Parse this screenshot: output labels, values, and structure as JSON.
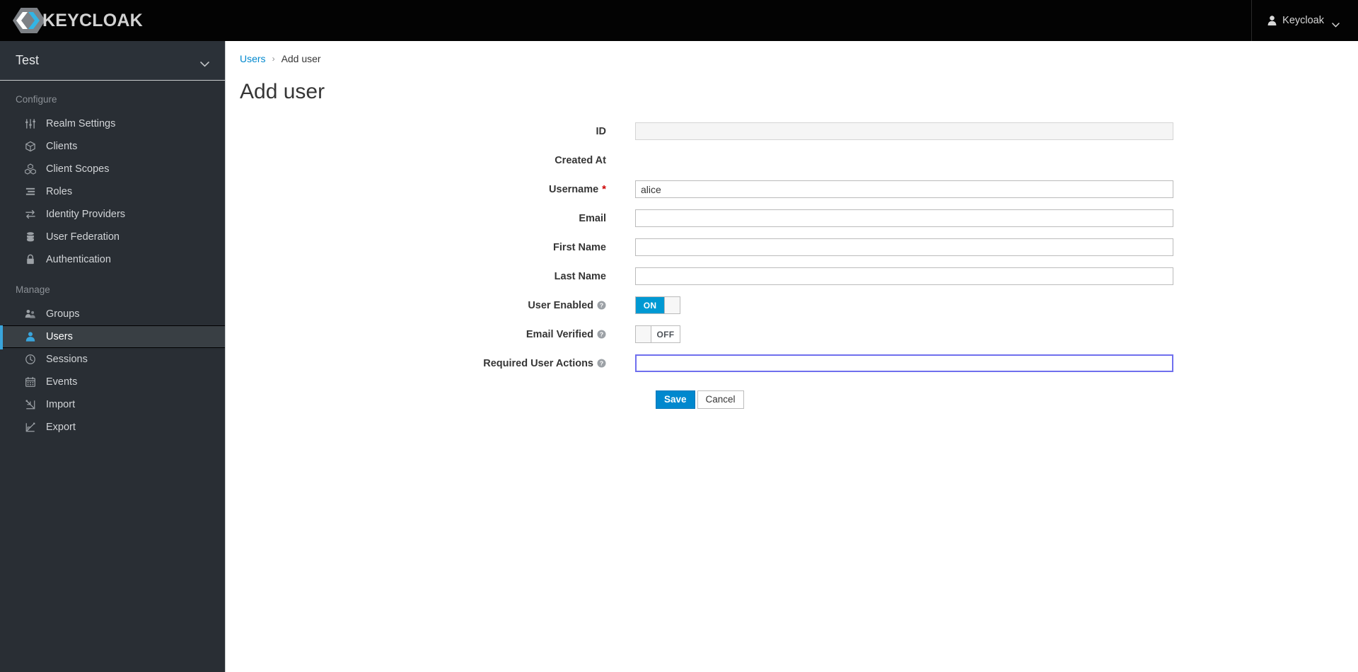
{
  "masthead": {
    "brand_name": "KEYCLOAK",
    "brand_logo_icon": "keycloak-hexagon-logo",
    "user_icon": "user-avatar-icon",
    "user_name": "Keycloak",
    "user_caret_icon": "chevron-down-icon"
  },
  "sidebar": {
    "realm": {
      "name": "Test",
      "caret_icon": "chevron-down-icon"
    },
    "sections": [
      {
        "title": "Configure",
        "items": [
          {
            "label": "Realm Settings",
            "icon": "sliders-icon",
            "active": false
          },
          {
            "label": "Clients",
            "icon": "cube-icon",
            "active": false
          },
          {
            "label": "Client Scopes",
            "icon": "cubes-icon",
            "active": false
          },
          {
            "label": "Roles",
            "icon": "list-lines-icon",
            "active": false
          },
          {
            "label": "Identity Providers",
            "icon": "exchange-arrows-icon",
            "active": false
          },
          {
            "label": "User Federation",
            "icon": "database-icon",
            "active": false
          },
          {
            "label": "Authentication",
            "icon": "lock-icon",
            "active": false
          }
        ]
      },
      {
        "title": "Manage",
        "items": [
          {
            "label": "Groups",
            "icon": "users-group-icon",
            "active": false
          },
          {
            "label": "Users",
            "icon": "user-icon",
            "active": true
          },
          {
            "label": "Sessions",
            "icon": "clock-icon",
            "active": false
          },
          {
            "label": "Events",
            "icon": "calendar-icon",
            "active": false
          },
          {
            "label": "Import",
            "icon": "import-arrow-icon",
            "active": false
          },
          {
            "label": "Export",
            "icon": "export-arrow-icon",
            "active": false
          }
        ]
      }
    ]
  },
  "content": {
    "breadcrumb": {
      "parent": "Users",
      "separator": "›",
      "current": "Add user"
    },
    "page_title": "Add user",
    "form": {
      "fields": [
        {
          "label": "ID",
          "type": "text",
          "value": "",
          "placeholder": "",
          "disabled": true,
          "required": false,
          "help": false,
          "focused": false
        },
        {
          "label": "Created At",
          "type": "none",
          "value": "",
          "placeholder": "",
          "disabled": false,
          "required": false,
          "help": false,
          "focused": false
        },
        {
          "label": "Username",
          "type": "text",
          "value": "alice",
          "placeholder": "",
          "disabled": false,
          "required": true,
          "help": false,
          "focused": false
        },
        {
          "label": "Email",
          "type": "text",
          "value": "",
          "placeholder": "",
          "disabled": false,
          "required": false,
          "help": false,
          "focused": false
        },
        {
          "label": "First Name",
          "type": "text",
          "value": "",
          "placeholder": "",
          "disabled": false,
          "required": false,
          "help": false,
          "focused": false
        },
        {
          "label": "Last Name",
          "type": "text",
          "value": "",
          "placeholder": "",
          "disabled": false,
          "required": false,
          "help": false,
          "focused": false
        }
      ],
      "toggles": [
        {
          "label": "User Enabled",
          "state": "ON",
          "on_label": "ON",
          "off_label": "OFF",
          "help": true
        },
        {
          "label": "Email Verified",
          "state": "OFF",
          "on_label": "ON",
          "off_label": "OFF",
          "help": true
        }
      ],
      "required_actions": {
        "label": "Required User Actions",
        "value": "",
        "placeholder": "",
        "help": true,
        "focused": true
      },
      "buttons": {
        "save": "Save",
        "cancel": "Cancel"
      }
    }
  },
  "colors": {
    "masthead_bg": "#030303",
    "sidebar_bg": "#292e34",
    "active_accent": "#39a5dc",
    "link_blue": "#0088ce",
    "toggle_on": "#0099d3",
    "required_red": "#cc0000",
    "focus_border": "#6f6fee"
  }
}
